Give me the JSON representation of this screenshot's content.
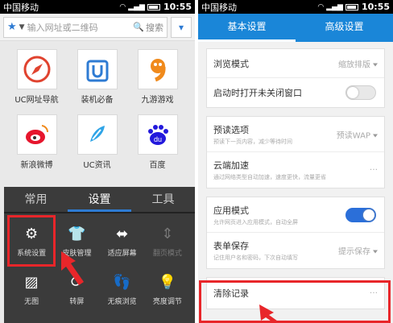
{
  "left_screen": {
    "status": {
      "carrier": "中国移动",
      "time": "10:55"
    },
    "search": {
      "placeholder": "输入网址或二维码",
      "search_label": "搜索"
    },
    "apps": [
      {
        "label": "UC网址导航",
        "icon": "compass-icon",
        "color": "#e0432f"
      },
      {
        "label": "装机必备",
        "icon": "u-bag-icon",
        "color": "#2e7bd3"
      },
      {
        "label": "九游游戏",
        "icon": "nine-game-icon",
        "color": "#f08a1c"
      },
      {
        "label": "新浪微博",
        "icon": "weibo-icon",
        "color": "#e6162d"
      },
      {
        "label": "UC资讯",
        "icon": "news-icon",
        "color": "#2fa4e7"
      },
      {
        "label": "百度",
        "icon": "baidu-icon",
        "color": "#2319dc"
      }
    ],
    "menu": {
      "tabs": [
        "常用",
        "设置",
        "工具"
      ],
      "active_tab": "设置",
      "items": [
        {
          "label": "系统设置",
          "icon": "gear-icon",
          "glyph": "⚙",
          "selected": true
        },
        {
          "label": "皮肤管理",
          "icon": "tshirt-icon",
          "glyph": "👕"
        },
        {
          "label": "适应屏幕",
          "icon": "fit-screen-icon",
          "glyph": "⬌"
        },
        {
          "label": "翻页模式",
          "icon": "page-updown-icon",
          "glyph": "⇕",
          "dim": true
        },
        {
          "label": "无图",
          "icon": "no-image-icon",
          "glyph": "▨"
        },
        {
          "label": "转屏",
          "icon": "rotate-screen-icon",
          "glyph": "⟳"
        },
        {
          "label": "无痕浏览",
          "icon": "footprint-icon",
          "glyph": "👣"
        },
        {
          "label": "亮度调节",
          "icon": "bulb-icon",
          "glyph": "💡"
        }
      ]
    }
  },
  "right_screen": {
    "status": {
      "carrier": "中国移动",
      "time": "10:55"
    },
    "tabs": [
      "基本设置",
      "高级设置"
    ],
    "active_tab": "基本设置",
    "accent": "#1a86d8",
    "rows": {
      "browse_mode": {
        "title": "浏览模式",
        "value": "缩放排版"
      },
      "open_unclosed": {
        "title": "启动时打开未关闭窗口",
        "toggle": false
      },
      "preread": {
        "title": "预读选项",
        "subtitle": "预读下一页内容，减少等待时间",
        "value": "预读WAP"
      },
      "cloud_accel": {
        "title": "云端加速",
        "subtitle": "通过网络类型自动加速，速度更快，流量更省"
      },
      "app_mode": {
        "title": "应用模式",
        "subtitle": "允许网页进入应用模式，自动全屏",
        "toggle": true
      },
      "form_save": {
        "title": "表单保存",
        "subtitle": "记住用户名和密码，下次自动填写",
        "value": "提示保存"
      },
      "clear_records": {
        "title": "清除记录"
      }
    }
  }
}
